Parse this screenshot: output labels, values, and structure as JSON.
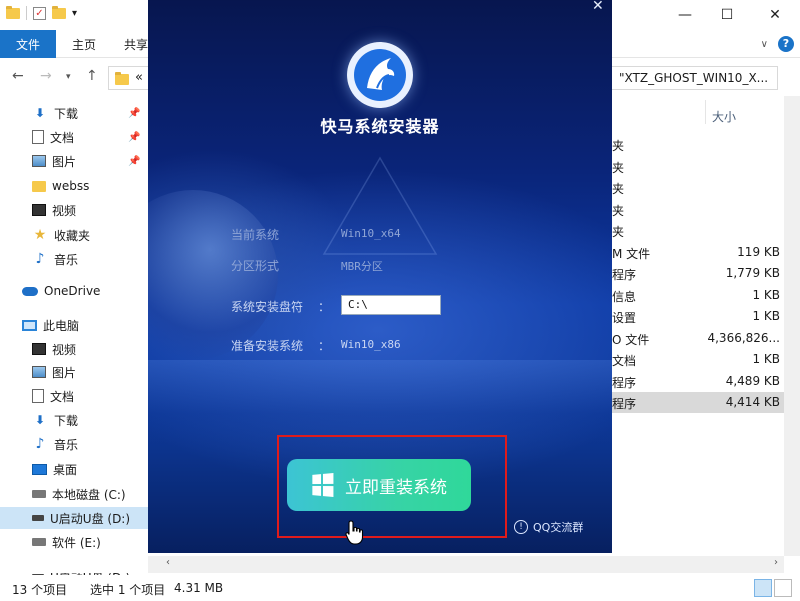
{
  "explorer": {
    "ribbon": {
      "file_tab": "文件",
      "home_tab": "主页",
      "share_tab": "共享"
    },
    "address": {
      "path_left": "«",
      "path_right": "\"XTZ_GHOST_WIN10_X..."
    },
    "window_controls": {
      "minimize": "—",
      "maximize": "☐",
      "close": "✕"
    },
    "nav_items": [
      {
        "label": "下载",
        "icon": "download-arrow-icon",
        "pinned": true
      },
      {
        "label": "文档",
        "icon": "document-icon",
        "pinned": true
      },
      {
        "label": "图片",
        "icon": "picture-icon",
        "pinned": true
      },
      {
        "label": "webss",
        "icon": "folder-icon",
        "pinned": false
      },
      {
        "label": "视频",
        "icon": "video-icon",
        "pinned": false
      },
      {
        "label": "收藏夹",
        "icon": "star-icon",
        "pinned": false
      },
      {
        "label": "音乐",
        "icon": "music-note-icon",
        "pinned": false
      },
      {
        "label": "OneDrive",
        "icon": "cloud-icon",
        "pinned": false
      },
      {
        "label": "此电脑",
        "icon": "computer-icon",
        "pinned": false
      },
      {
        "label": "视频",
        "icon": "video-icon",
        "pinned": false
      },
      {
        "label": "图片",
        "icon": "picture-icon",
        "pinned": false
      },
      {
        "label": "文档",
        "icon": "document-icon",
        "pinned": false
      },
      {
        "label": "下载",
        "icon": "download-arrow-icon",
        "pinned": false
      },
      {
        "label": "音乐",
        "icon": "music-note-icon",
        "pinned": false
      },
      {
        "label": "桌面",
        "icon": "desktop-icon",
        "pinned": false
      },
      {
        "label": "本地磁盘 (C:)",
        "icon": "hard-drive-icon",
        "pinned": false
      },
      {
        "label": "U启动U盘 (D:)",
        "icon": "usb-drive-icon",
        "pinned": false,
        "selected": true
      },
      {
        "label": "软件 (E:)",
        "icon": "drive-icon",
        "pinned": false
      },
      {
        "label": "U启动U盘 (D:)",
        "icon": "usb-drive-icon",
        "pinned": false
      }
    ],
    "columns": {
      "size": "大小"
    },
    "files": [
      {
        "type": "夹",
        "size": ""
      },
      {
        "type": "夹",
        "size": ""
      },
      {
        "type": "夹",
        "size": ""
      },
      {
        "type": "夹",
        "size": ""
      },
      {
        "type": "夹",
        "size": ""
      },
      {
        "type": "M 文件",
        "size": "119 KB"
      },
      {
        "type": "程序",
        "size": "1,779 KB"
      },
      {
        "type": "信息",
        "size": "1 KB"
      },
      {
        "type": "设置",
        "size": "1 KB"
      },
      {
        "type": "O 文件",
        "size": "4,366,826..."
      },
      {
        "type": "文档",
        "size": "1 KB"
      },
      {
        "type": "程序",
        "size": "4,489 KB"
      },
      {
        "type": "程序",
        "size": "4,414 KB",
        "selected": true
      }
    ],
    "status": {
      "count": "13 个项目",
      "selected": "选中 1 个项目",
      "size": "4.31 MB"
    }
  },
  "installer": {
    "title": "快马系统安装器",
    "close": "✕",
    "info": {
      "current_system_label": "当前系统",
      "current_system_value": "Win10_x64",
      "partition_label": "分区形式",
      "partition_value": "MBR分区",
      "drive_label": "系统安装盘符",
      "drive_colon": "：",
      "drive_value": "C:\\",
      "prepare_label": "准备安装系统",
      "prepare_colon": "：",
      "prepare_value": "Win10_x86"
    },
    "install_button": "立即重装系统",
    "qq_group": "QQ交流群",
    "colors": {
      "button_start": "#3cc4d4",
      "button_end": "#2fd89a",
      "highlight": "#e01b1b"
    }
  }
}
